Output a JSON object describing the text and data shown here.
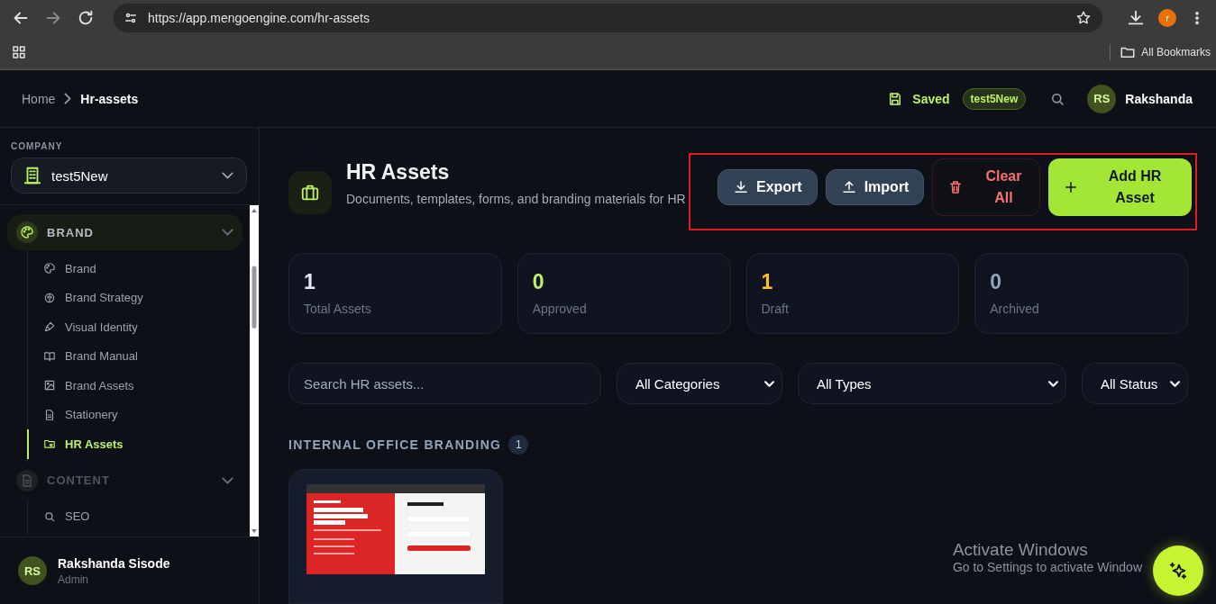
{
  "browser": {
    "url": "https://app.mengoengine.com/hr-assets",
    "profile_initial": "r",
    "bookmarks_label": "All Bookmarks"
  },
  "header": {
    "breadcrumbs": [
      "Home",
      "Hr-assets"
    ],
    "saved_label": "Saved",
    "company_badge": "test5New",
    "user_initials": "RS",
    "user_name": "Rakshanda"
  },
  "sidebar": {
    "company_label": "COMPANY",
    "company": "test5New",
    "groups": [
      {
        "label": "BRAND",
        "selected": true,
        "items": [
          {
            "label": "Brand",
            "selected": false
          },
          {
            "label": "Brand Strategy",
            "selected": false
          },
          {
            "label": "Visual Identity",
            "selected": false
          },
          {
            "label": "Brand Manual",
            "selected": false
          },
          {
            "label": "Brand Assets",
            "selected": false
          },
          {
            "label": "Stationery",
            "selected": false
          },
          {
            "label": "HR Assets",
            "selected": true
          }
        ]
      },
      {
        "label": "CONTENT",
        "selected": false,
        "items": [
          {
            "label": "SEO",
            "selected": false
          }
        ]
      }
    ],
    "user": {
      "initials": "RS",
      "name": "Rakshanda Sisode",
      "role": "Admin"
    }
  },
  "page": {
    "title": "HR Assets",
    "description": "Documents, templates, forms, and branding materials for HR",
    "actions": [
      {
        "label": "Export",
        "kind": "export"
      },
      {
        "label": "Import",
        "kind": "import"
      },
      {
        "label": "Clear All",
        "kind": "danger"
      },
      {
        "label": "Add HR Asset",
        "kind": "primary"
      }
    ],
    "stats": [
      {
        "value": "1",
        "label": "Total Assets",
        "color": "#e2e8f0"
      },
      {
        "value": "0",
        "label": "Approved",
        "color": "#bef264"
      },
      {
        "value": "1",
        "label": "Draft",
        "color": "#fbbf24"
      },
      {
        "value": "0",
        "label": "Archived",
        "color": "#94a3b8"
      }
    ],
    "search": {
      "placeholder": "Search HR assets..."
    },
    "filters": [
      "All Categories",
      "All Types",
      "All Status"
    ],
    "section": {
      "title": "INTERNAL OFFICE BRANDING",
      "count": "1"
    }
  },
  "os_notice": {
    "title": "Activate Windows",
    "text": "Go to Settings to activate Window"
  }
}
